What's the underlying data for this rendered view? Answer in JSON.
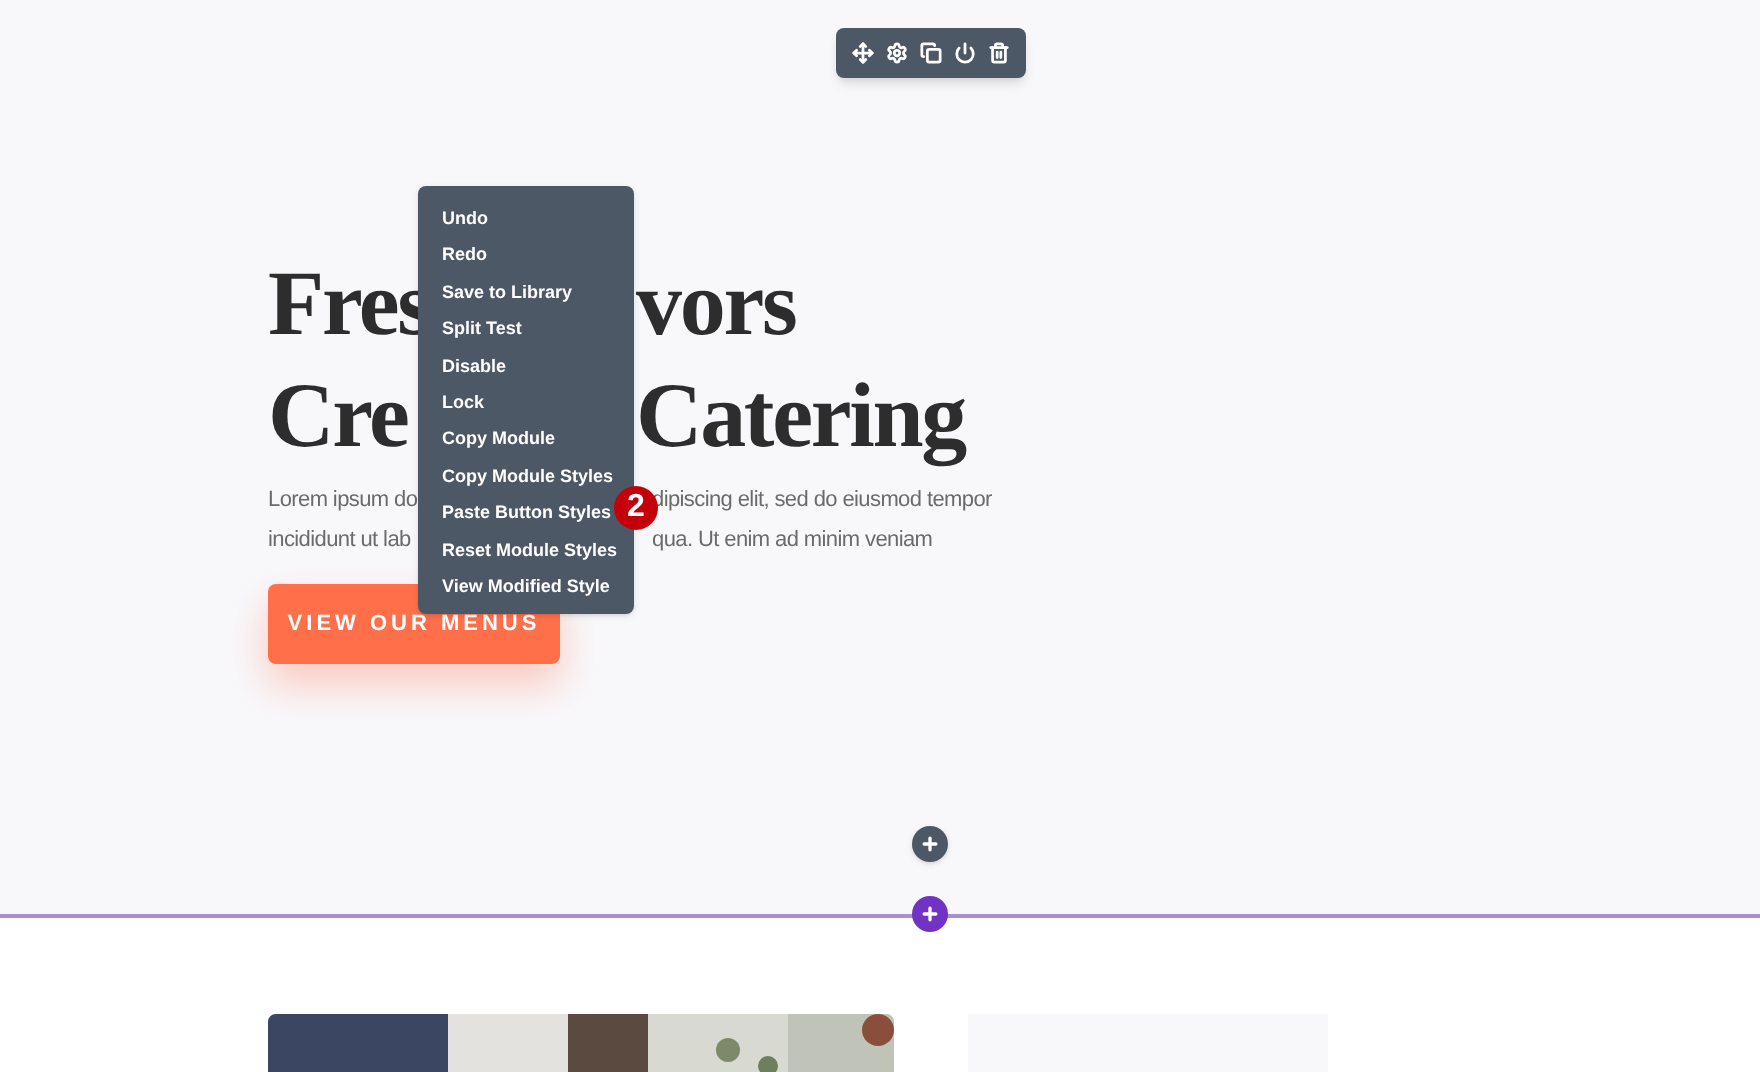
{
  "hero": {
    "heading_lines": [
      {
        "left": "Fres",
        "right": "vors"
      },
      {
        "left": "Cre",
        "right": "Catering"
      }
    ],
    "paragraph_lines": [
      {
        "left": "Lorem ipsum do",
        "right": "dipiscing elit, sed do eiusmod tempor"
      },
      {
        "left": "incididunt ut lab",
        "right": "qua. Ut enim ad minim veniam"
      }
    ],
    "button": "VIEW OUR MENUS"
  },
  "context_menu": {
    "items": [
      "Undo",
      "Redo",
      "Save to Library",
      "Split Test",
      "Disable",
      "Lock",
      "Copy Module",
      "Copy Module Styles",
      "Paste Button Styles",
      "Reset Module Styles",
      "View Modified Style"
    ]
  },
  "step_badge": "2"
}
